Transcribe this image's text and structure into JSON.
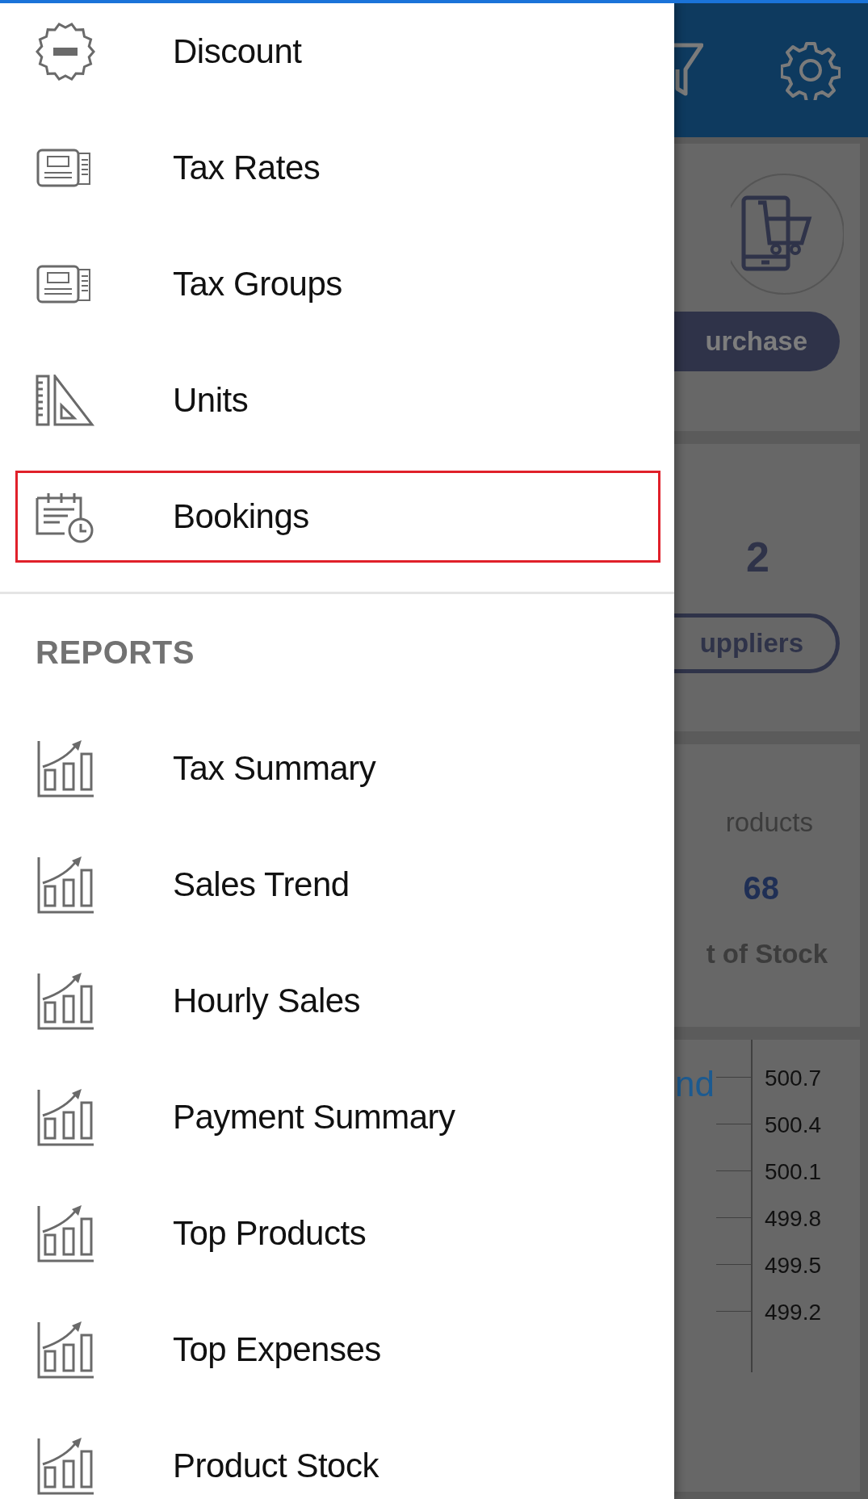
{
  "drawer": {
    "items": [
      {
        "label": "Discount",
        "kind": "sale",
        "selected": false
      },
      {
        "label": "Tax Rates",
        "kind": "tax",
        "selected": false
      },
      {
        "label": "Tax Groups",
        "kind": "tax",
        "selected": false
      },
      {
        "label": "Units",
        "kind": "units",
        "selected": false
      },
      {
        "label": "Bookings",
        "kind": "bookings",
        "selected": true
      }
    ],
    "reports_header": "REPORTS",
    "reports": [
      {
        "label": "Tax Summary",
        "kind": "chart",
        "selected": false
      },
      {
        "label": "Sales Trend",
        "kind": "chart",
        "selected": false
      },
      {
        "label": "Hourly Sales",
        "kind": "chart",
        "selected": false
      },
      {
        "label": "Payment Summary",
        "kind": "chart",
        "selected": false
      },
      {
        "label": "Top Products",
        "kind": "chart",
        "selected": false
      },
      {
        "label": "Top Expenses",
        "kind": "chart",
        "selected": false
      },
      {
        "label": "Product Stock",
        "kind": "chart",
        "selected": false
      }
    ]
  },
  "background": {
    "purchase_button": "urchase",
    "suppliers_count": "2",
    "suppliers_button": "uppliers",
    "products_label": "roducts",
    "products_count": "68",
    "out_of_stock_label": "t of Stock",
    "chart_title": "nd",
    "axis_labels": [
      "500.7",
      "500.4",
      "500.1",
      "499.8",
      "499.5",
      "499.2"
    ]
  }
}
